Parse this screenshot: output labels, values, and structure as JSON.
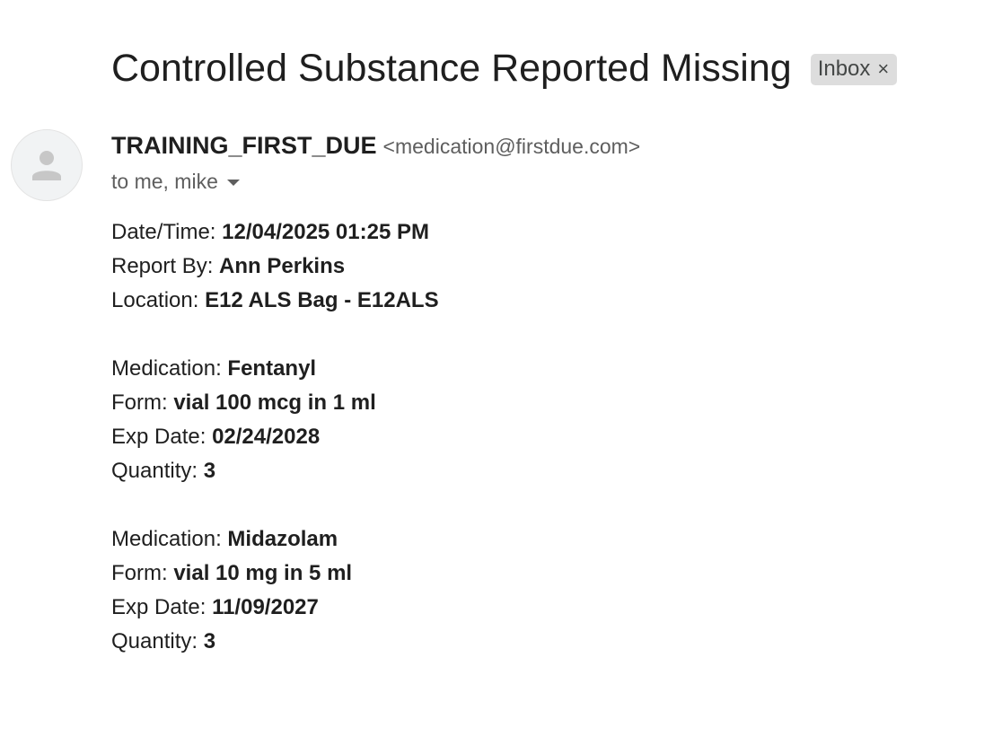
{
  "email": {
    "subject": "Controlled Substance Reported Missing",
    "label": "Inbox",
    "label_close": "×",
    "sender_name": "TRAINING_FIRST_DUE",
    "sender_email": "<medication@firstdue.com>",
    "recipients": "to me, mike"
  },
  "report": {
    "datetime_label": "Date/Time: ",
    "datetime_value": "12/04/2025 01:25 PM",
    "report_by_label": "Report By: ",
    "report_by_value": "Ann Perkins",
    "location_label": "Location: ",
    "location_value": "E12 ALS Bag - E12ALS"
  },
  "medications": [
    {
      "medication_label": "Medication: ",
      "medication_value": "Fentanyl",
      "form_label": "Form: ",
      "form_value": "vial 100 mcg in 1 ml",
      "exp_label": "Exp Date: ",
      "exp_value": "02/24/2028",
      "quantity_label": "Quantity: ",
      "quantity_value": "3"
    },
    {
      "medication_label": "Medication: ",
      "medication_value": "Midazolam",
      "form_label": "Form: ",
      "form_value": "vial 10 mg in 5 ml",
      "exp_label": "Exp Date: ",
      "exp_value": "11/09/2027",
      "quantity_label": "Quantity: ",
      "quantity_value": "3"
    }
  ],
  "icons": {
    "avatar": "person-avatar-icon",
    "dropdown": "chevron-down-icon",
    "chip_close": "close-icon"
  },
  "colors": {
    "chip_background": "#dddddd",
    "avatar_background": "#f1f3f4",
    "avatar_figure": "#c7c7c7",
    "secondary_text": "#5e5e5e"
  }
}
